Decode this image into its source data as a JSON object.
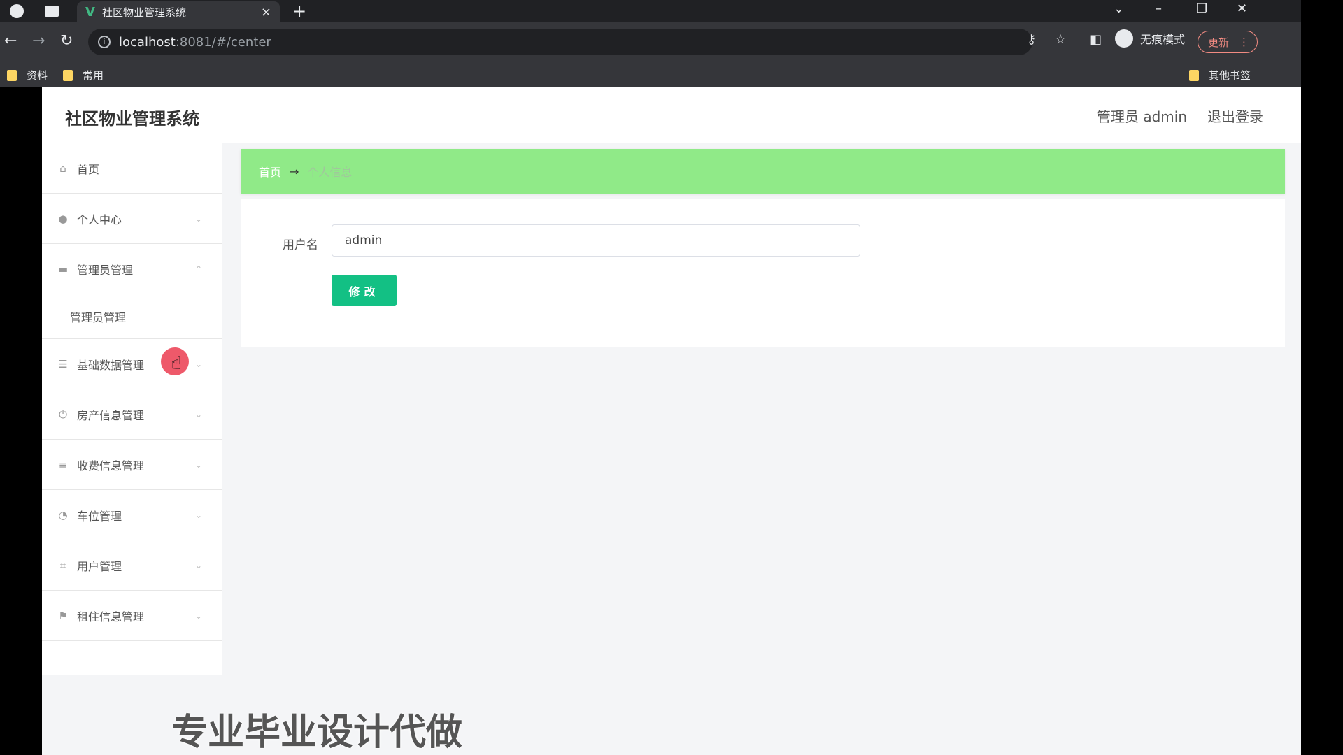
{
  "browser": {
    "tab_title": "社区物业管理系统",
    "tab_close": "×",
    "new_tab": "+",
    "url_host": "localhost",
    "url_path": ":8081/#/center",
    "incognito_label": "无痕模式",
    "update_label": "更新",
    "bookmarks": [
      "资料",
      "常用"
    ],
    "other_bookmarks": "其他书签",
    "icons": [
      "back-icon",
      "forward-icon",
      "reload-icon",
      "info-icon",
      "key-icon",
      "star-icon",
      "sidepanel-icon",
      "incognito-icon",
      "more-icon",
      "minimize-icon",
      "restore-icon",
      "close-icon"
    ]
  },
  "header": {
    "brand": "社区物业管理系统",
    "user": "管理员 admin",
    "logout": "退出登录"
  },
  "sidebar": {
    "items": [
      {
        "label": "首页",
        "icon": "home-icon"
      },
      {
        "label": "个人中心",
        "icon": "user-icon"
      },
      {
        "label": "管理员管理",
        "icon": "monitor-icon"
      },
      {
        "label": "管理员管理",
        "icon": ""
      },
      {
        "label": "基础数据管理",
        "icon": "sliders-icon"
      },
      {
        "label": "房产信息管理",
        "icon": "power-icon"
      },
      {
        "label": "收费信息管理",
        "icon": "list-icon"
      },
      {
        "label": "车位管理",
        "icon": "gauge-icon"
      },
      {
        "label": "用户管理",
        "icon": "crop-icon"
      },
      {
        "label": "租住信息管理",
        "icon": "flag-icon"
      }
    ]
  },
  "breadcrumb": {
    "home": "首页",
    "separator": "→",
    "current": "个人信息"
  },
  "form": {
    "username_label": "用户名",
    "username_value": "admin",
    "submit_label": "修改"
  },
  "overlay": {
    "watermark": "专业毕业设计代做"
  },
  "colors": {
    "breadcrumb_bg": "#90ea88",
    "button_bg": "#13c084",
    "cursor_highlight": "#eb3c50"
  }
}
